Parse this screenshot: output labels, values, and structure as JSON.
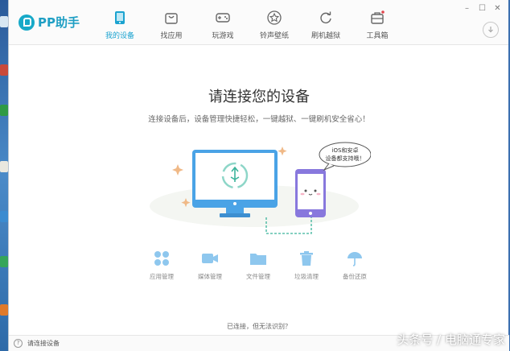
{
  "app": {
    "logo_text": "PP助手",
    "accent_color": "#1ba3d0"
  },
  "nav": {
    "items": [
      {
        "label": "我的设备",
        "icon": "phone-icon",
        "active": true
      },
      {
        "label": "找应用",
        "icon": "bag-icon",
        "active": false
      },
      {
        "label": "玩游戏",
        "icon": "gamepad-icon",
        "active": false
      },
      {
        "label": "铃声壁纸",
        "icon": "star-icon",
        "active": false
      },
      {
        "label": "刷机越狱",
        "icon": "refresh-icon",
        "active": false
      },
      {
        "label": "工具箱",
        "icon": "toolbox-icon",
        "active": false
      }
    ]
  },
  "window_controls": {
    "minimize": "–",
    "maximize": "☐",
    "close": "✕"
  },
  "main": {
    "headline": "请连接您的设备",
    "subline": "连接设备后，设备管理快捷轻松，一键越狱、一键刷机安全省心！",
    "speech_bubble": [
      "iOS和安卓",
      "设备都支持哦！"
    ]
  },
  "features": [
    {
      "label": "应用管理",
      "icon": "apps-grid-icon"
    },
    {
      "label": "媒体管理",
      "icon": "video-camera-icon"
    },
    {
      "label": "文件管理",
      "icon": "folder-icon"
    },
    {
      "label": "垃圾清理",
      "icon": "trash-icon"
    },
    {
      "label": "备份还原",
      "icon": "umbrella-icon"
    }
  ],
  "detect_link": "已连接，但无法识别？",
  "statusbar": {
    "help": "?",
    "text": "请连接设备"
  },
  "watermark": "头条号 / 电脑通专家"
}
